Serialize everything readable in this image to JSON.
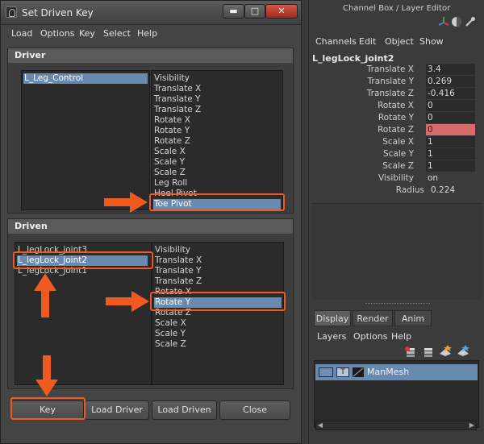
{
  "sdk": {
    "title": "Set Driven Key",
    "window_controls": {
      "minimize": "▬",
      "maximize": "□",
      "close": "✕"
    },
    "menu": [
      "Load",
      "Options",
      "Key",
      "Select",
      "Help"
    ],
    "driver": {
      "header": "Driver",
      "objects": [
        "L_Leg_Control"
      ],
      "attributes": [
        "Visibility",
        "Translate X",
        "Translate Y",
        "Translate Z",
        "Rotate X",
        "Rotate Y",
        "Rotate Z",
        "Scale X",
        "Scale Y",
        "Scale Z",
        "Leg Roll",
        "Heel Pivot",
        "Toe Pivot"
      ],
      "selected_object": "L_Leg_Control",
      "selected_attribute": "Toe Pivot"
    },
    "driven": {
      "header": "Driven",
      "objects": [
        "L_legLock_joint3",
        "L_legLock_joint2",
        "L_legLock_joint1"
      ],
      "attributes": [
        "Visibility",
        "Translate X",
        "Translate Y",
        "Translate Z",
        "Rotate X",
        "Rotate Y",
        "Rotate Z",
        "Scale X",
        "Scale Y",
        "Scale Z"
      ],
      "selected_object": "L_legLock_joint2",
      "selected_attribute": "Rotate Y"
    },
    "buttons": {
      "key": "Key",
      "load_driver": "Load Driver",
      "load_driven": "Load Driven",
      "close": "Close"
    }
  },
  "channel_box": {
    "title": "Channel Box / Layer Editor",
    "menu": [
      "Channels",
      "Edit",
      "Object",
      "Show"
    ],
    "object_name": "L_legLock_joint2",
    "channels": [
      {
        "label": "Translate X",
        "value": "3.4"
      },
      {
        "label": "Translate Y",
        "value": "0.269"
      },
      {
        "label": "Translate Z",
        "value": "-0.416"
      },
      {
        "label": "Rotate X",
        "value": "0"
      },
      {
        "label": "Rotate Y",
        "value": "0"
      },
      {
        "label": "Rotate Z",
        "value": "0"
      },
      {
        "label": "Scale X",
        "value": "1"
      },
      {
        "label": "Scale Y",
        "value": "1"
      },
      {
        "label": "Scale Z",
        "value": "1"
      },
      {
        "label": "Visibility",
        "value": "on"
      },
      {
        "label": "Radius",
        "value": "0.224"
      }
    ],
    "keyed_color": "#d66a6c"
  },
  "layer_editor": {
    "tabs": [
      "Display",
      "Render",
      "Anim"
    ],
    "active_tab": "Display",
    "menu": [
      "Layers",
      "Options",
      "Help"
    ],
    "layer": {
      "visibility_flag": "",
      "type_flag": "T",
      "name": "ManMesh"
    }
  },
  "colors": {
    "selection": "#6889b0",
    "highlight_annotation": "#f05a1e"
  }
}
